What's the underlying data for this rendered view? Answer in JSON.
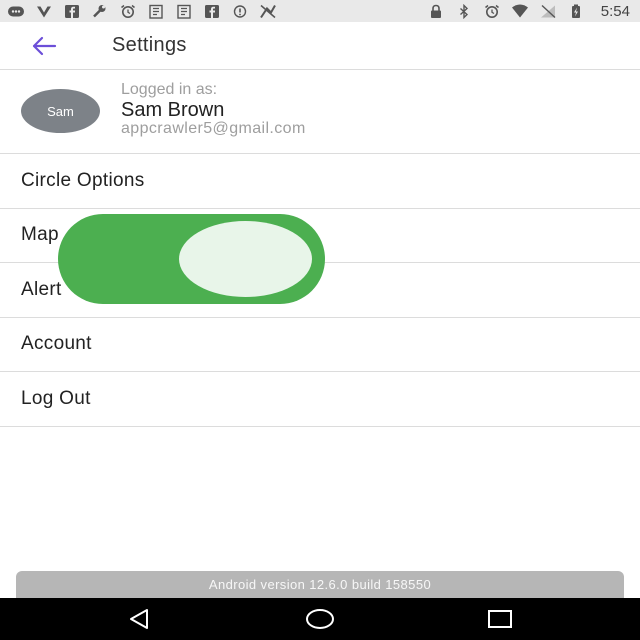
{
  "status_bar": {
    "time": "5:54",
    "left_icons": [
      "chat-icon",
      "vpn-icon",
      "facebook-icon",
      "wrench-icon",
      "alarm-icon",
      "clipboard-icon",
      "clipboard-icon",
      "facebook-icon",
      "info-icon",
      "no-signal-icon"
    ],
    "right_icons": [
      "lock-icon",
      "bluetooth-icon",
      "alarm-icon",
      "wifi-icon",
      "no-sim-icon",
      "battery-charging-icon"
    ]
  },
  "app_bar": {
    "back_icon": "arrow-left-icon",
    "title": "Settings",
    "accent_color": "#6c4fd8"
  },
  "profile": {
    "avatar_text": "Sam",
    "logged_in_label": "Logged in as:",
    "name": "Sam Brown",
    "email": "appcrawler5@gmail.com"
  },
  "menu": {
    "items": [
      {
        "label": "Circle Options"
      },
      {
        "label": "Map"
      },
      {
        "label": "Alert"
      },
      {
        "label": "Account"
      },
      {
        "label": "Log Out"
      }
    ]
  },
  "toggle": {
    "state": "on",
    "track_color": "#4caf50",
    "knob_color": "#e8f5e9"
  },
  "footer": {
    "version_text": "Android version 12.6.0 build 158550"
  },
  "nav_bar": {
    "buttons": [
      "back-triangle-icon",
      "home-circle-icon",
      "recents-square-icon"
    ]
  }
}
